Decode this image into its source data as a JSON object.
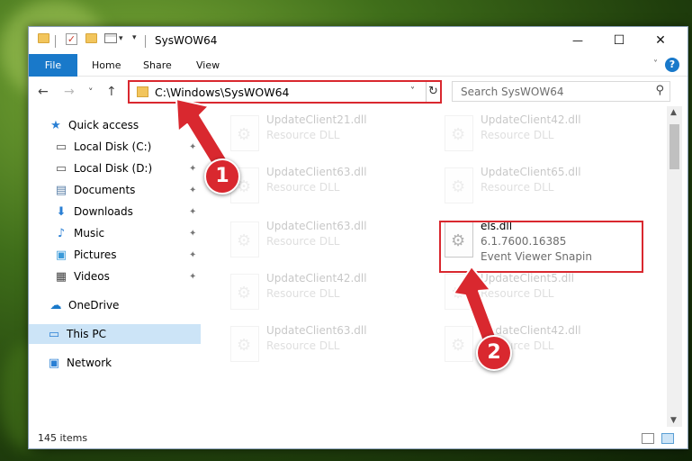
{
  "window": {
    "title": "SysWOW64",
    "minimize_glyph": "—",
    "maximize_glyph": "☐",
    "close_glyph": "✕"
  },
  "ribbon": {
    "tabs": [
      "File",
      "Home",
      "Share",
      "View"
    ],
    "help_glyph": "?"
  },
  "nav": {
    "back_glyph": "←",
    "forward_glyph": "→",
    "recent_glyph": "˅",
    "up_glyph": "↑",
    "address": "C:\\Windows\\SysWOW64",
    "dropdown_glyph": "˅",
    "refresh_glyph": "↻",
    "search_placeholder": "Search SysWOW64",
    "search_glyph": "⚲"
  },
  "sidebar": {
    "items": [
      {
        "label": "Quick access",
        "icon": "star-icon",
        "glyph": "★",
        "color": "#2a7fd4"
      },
      {
        "label": "Local Disk (C:)",
        "icon": "drive-icon",
        "glyph": "▭",
        "color": "#555555",
        "pinned": true
      },
      {
        "label": "Local Disk (D:)",
        "icon": "drive-icon",
        "glyph": "▭",
        "color": "#555555",
        "pinned": true
      },
      {
        "label": "Documents",
        "icon": "documents-icon",
        "glyph": "▤",
        "color": "#5a7fa8",
        "pinned": true
      },
      {
        "label": "Downloads",
        "icon": "downloads-icon",
        "glyph": "⬇",
        "color": "#2a7fd4",
        "pinned": true
      },
      {
        "label": "Music",
        "icon": "music-icon",
        "glyph": "♪",
        "color": "#2a7fd4",
        "pinned": true
      },
      {
        "label": "Pictures",
        "icon": "pictures-icon",
        "glyph": "▣",
        "color": "#3a9ad9",
        "pinned": true
      },
      {
        "label": "Videos",
        "icon": "videos-icon",
        "glyph": "▦",
        "color": "#444444",
        "pinned": true
      },
      {
        "label": "OneDrive",
        "icon": "onedrive-icon",
        "glyph": "☁",
        "color": "#1979ca"
      },
      {
        "label": "This PC",
        "icon": "computer-icon",
        "glyph": "▭",
        "color": "#2a7fd4",
        "selected": true
      },
      {
        "label": "Network",
        "icon": "network-icon",
        "glyph": "▣",
        "color": "#2a7fd4"
      }
    ],
    "pin_glyph": "📌"
  },
  "files": {
    "gear_glyph": "⚙",
    "tiles": [
      {
        "name": "UpdateClient21.dll",
        "line2": "Resource DLL",
        "faded": true
      },
      {
        "name": "UpdateClient42.dll",
        "line2": "Resource DLL",
        "faded": true
      },
      {
        "name": "UpdateClient63.dll",
        "line2": "Resource DLL",
        "faded": true
      },
      {
        "name": "UpdateClient65.dll",
        "line2": "Resource DLL",
        "faded": true
      },
      {
        "name": "UpdateClient63.dll",
        "line2": "Resource DLL",
        "faded": true
      },
      {
        "name": "els.dll",
        "line2": "6.1.7600.16385",
        "line3": "Event Viewer Snapin",
        "faded": false
      },
      {
        "name": "UpdateClient42.dll",
        "line2": "Resource DLL",
        "faded": true
      },
      {
        "name": "UpdateClient5.dll",
        "line2": "Resource DLL",
        "faded": true
      },
      {
        "name": "UpdateClient63.dll",
        "line2": "Resource DLL",
        "faded": true
      },
      {
        "name": "UpdateClient42.dll",
        "line2": "Resource DLL",
        "faded": true
      }
    ]
  },
  "status": {
    "count": "145 items"
  },
  "annotations": {
    "step1": "1",
    "step2": "2",
    "color": "#d9282f"
  },
  "scroll": {
    "up_glyph": "▲",
    "down_glyph": "▼"
  }
}
